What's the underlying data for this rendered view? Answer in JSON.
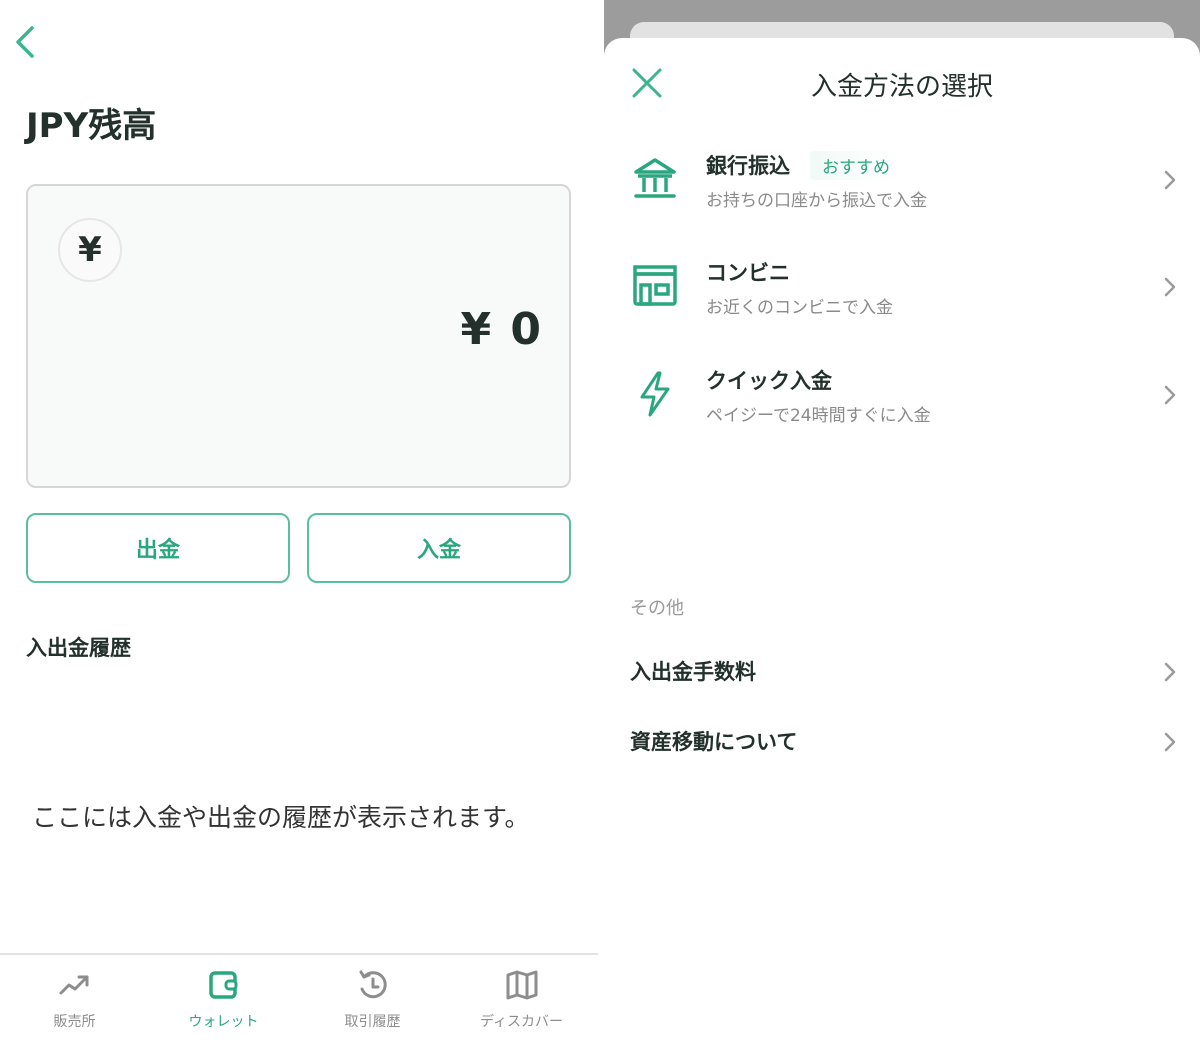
{
  "wallet": {
    "back_icon": "chevron-left-icon",
    "title": "JPY残高",
    "coin_symbol": "¥",
    "balance": "¥ 0",
    "withdraw_label": "出金",
    "deposit_label": "入金",
    "history_title": "入出金履歴",
    "empty_message": "ここには入金や出金の履歴が表示されます。"
  },
  "tabbar": {
    "items": [
      {
        "label": "販売所",
        "icon": "trending-up-icon",
        "active": false
      },
      {
        "label": "ウォレット",
        "icon": "wallet-icon",
        "active": true
      },
      {
        "label": "取引履歴",
        "icon": "history-icon",
        "active": false
      },
      {
        "label": "ディスカバー",
        "icon": "map-icon",
        "active": false
      }
    ]
  },
  "deposit_sheet": {
    "close_icon": "close-icon",
    "title": "入金方法の選択",
    "methods": [
      {
        "name": "銀行振込",
        "badge": "おすすめ",
        "description": "お持ちの口座から振込で入金",
        "icon": "bank-icon"
      },
      {
        "name": "コンビニ",
        "badge": "",
        "description": "お近くのコンビニで入金",
        "icon": "store-icon"
      },
      {
        "name": "クイック入金",
        "badge": "",
        "description": "ペイジーで24時間すぐに入金",
        "icon": "lightning-icon"
      }
    ],
    "other_label": "その他",
    "links": [
      {
        "label": "入出金手数料"
      },
      {
        "label": "資産移動について"
      }
    ]
  },
  "colors": {
    "accent": "#2aa77f",
    "text_primary": "#23302b",
    "text_secondary": "#8a8a8a",
    "overlay": "#9c9c9c"
  }
}
